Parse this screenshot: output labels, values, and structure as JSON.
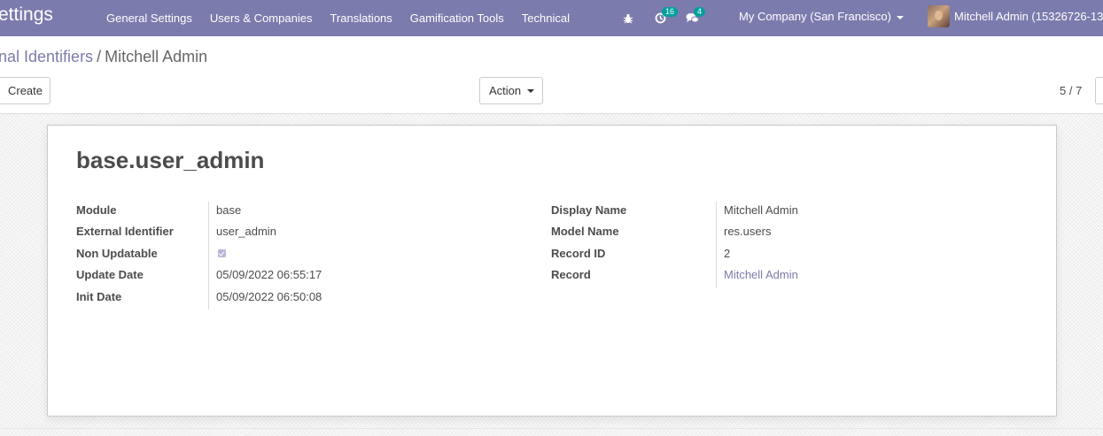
{
  "app": {
    "title": "ettings"
  },
  "nav": {
    "menu": [
      "General Settings",
      "Users & Companies",
      "Translations",
      "Gamification Tools",
      "Technical"
    ],
    "activity_count": "16",
    "messages_count": "4",
    "company": "My Company (San Francisco)",
    "user": "Mitchell Admin (15326726-13"
  },
  "breadcrumb": {
    "parent": "nal Identifiers",
    "separator": "/",
    "current": "Mitchell Admin"
  },
  "toolbar": {
    "create": "Create",
    "action": "Action"
  },
  "pager": {
    "text": "5 / 7"
  },
  "record": {
    "title": "base.user_admin",
    "left": [
      {
        "label": "Module",
        "value": "base"
      },
      {
        "label": "External Identifier",
        "value": "user_admin"
      },
      {
        "label": "Non Updatable",
        "value": true
      },
      {
        "label": "Update Date",
        "value": "05/09/2022 06:55:17"
      },
      {
        "label": "Init Date",
        "value": "05/09/2022 06:50:08"
      }
    ],
    "right": [
      {
        "label": "Display Name",
        "value": "Mitchell Admin"
      },
      {
        "label": "Model Name",
        "value": "res.users"
      },
      {
        "label": "Record ID",
        "value": "2"
      },
      {
        "label": "Record",
        "value": "Mitchell Admin"
      }
    ]
  },
  "colors": {
    "navbar": "#7C7BAD",
    "badge": "#00A09D",
    "link": "#7C7BAD"
  },
  "icons": [
    "bug-icon",
    "clock-icon",
    "chat-icon",
    "caret-down-icon"
  ]
}
